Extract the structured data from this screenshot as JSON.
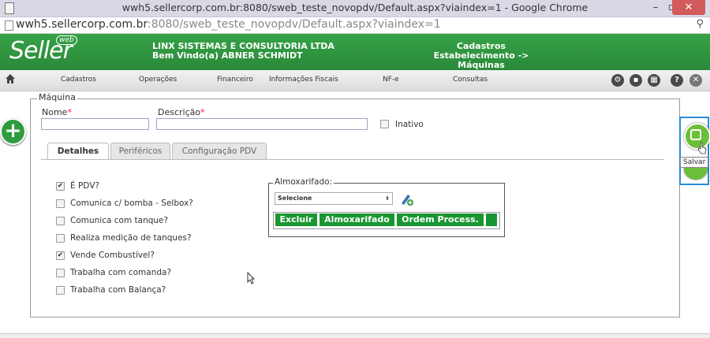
{
  "browser": {
    "title": "wwh5.sellercorp.com.br:8080/sweb_teste_novopdv/Default.aspx?viaindex=1 - Google Chrome",
    "url_host": "wwh5.sellercorp.com.br",
    "url_rest": ":8080/sweb_teste_novopdv/Default.aspx?viaindex=1"
  },
  "header": {
    "logo": "Seller",
    "logo_badge": "web",
    "company": "LINX SISTEMAS E CONSULTORIA LTDA",
    "welcome": "Bem Vindo(a) ABNER SCHMIDT",
    "section": "Cadastros",
    "breadcrumb": "Estabelecimento -> Máquinas"
  },
  "menu": {
    "items": [
      "Cadastros",
      "Operações",
      "Financeiro",
      "Informações Fiscais",
      "NF-e",
      "Consultas"
    ]
  },
  "form": {
    "legend": "Máquina",
    "nome_label": "Nome",
    "descricao_label": "Descrição",
    "required_mark": "*",
    "nome_value": "",
    "descricao_value": "",
    "inativo_label": "Inativo",
    "inativo_checked": false
  },
  "tabs": [
    "Detalhes",
    "Periféricos",
    "Configuração PDV"
  ],
  "options": [
    {
      "label": "É PDV?",
      "checked": true
    },
    {
      "label": "Comunica c/ bomba - Selbox?",
      "checked": false
    },
    {
      "label": "Comunica com tanque?",
      "checked": false
    },
    {
      "label": "Realiza medição de tanques?",
      "checked": false
    },
    {
      "label": "Vende Combustível?",
      "checked": true
    },
    {
      "label": "Trabalha com comanda?",
      "checked": false
    },
    {
      "label": "Trabalha com Balança?",
      "checked": false
    }
  ],
  "almoxarifado": {
    "legend": "Almoxarifado:",
    "select_value": "Selecione",
    "columns": [
      "Excluir",
      "Almoxarifado",
      "Ordem Process."
    ]
  },
  "actions": {
    "save_tooltip": "Salvar"
  },
  "colors": {
    "brand_green": "#2a8a3a",
    "grid_header": "#199632",
    "focus_border": "#2b8bd8"
  }
}
